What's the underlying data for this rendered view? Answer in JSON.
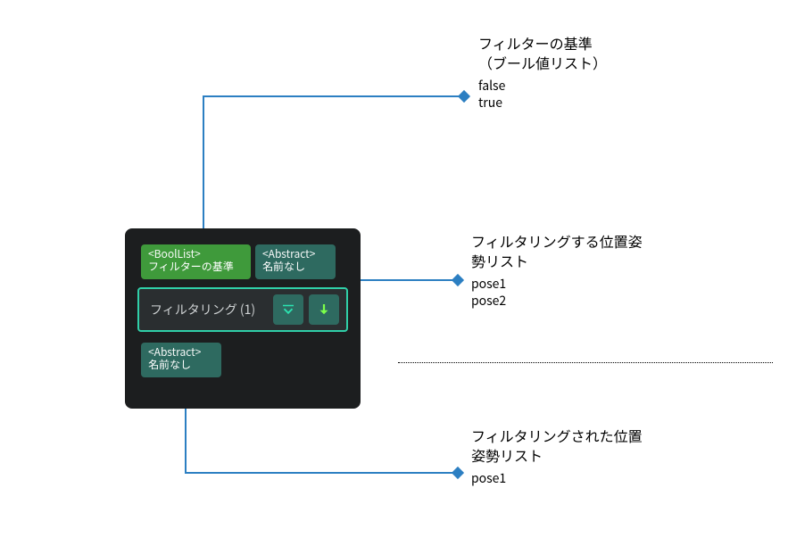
{
  "node": {
    "ports": {
      "bool_in": {
        "type": "<BoolList>",
        "label": "フィルターの基準"
      },
      "abs_in": {
        "type": "<Abstract>",
        "label": "名前なし"
      },
      "abs_out": {
        "type": "<Abstract>",
        "label": "名前なし"
      }
    },
    "op": {
      "label": "フィルタリング (1)",
      "icon1_name": "collapse-icon",
      "icon2_name": "insert-down-icon"
    }
  },
  "annotations": {
    "filter_basis": {
      "title_line1": "フィルターの基準",
      "title_line2": "（ブール値リスト）",
      "items": [
        "false",
        "true"
      ]
    },
    "pose_in": {
      "title_line1": "フィルタリングする位置姿",
      "title_line2": "勢リスト",
      "items": [
        "pose1",
        "pose2"
      ]
    },
    "pose_out": {
      "title_line1": "フィルタリングされた位置",
      "title_line2": "姿勢リスト",
      "items": [
        "pose1"
      ]
    }
  },
  "colors": {
    "connector": "#2c7fc2",
    "node_bg": "#1c1e1f",
    "op_border": "#30cfa8",
    "port_bool": "#3f9a3b",
    "port_abs": "#2e6a60"
  }
}
